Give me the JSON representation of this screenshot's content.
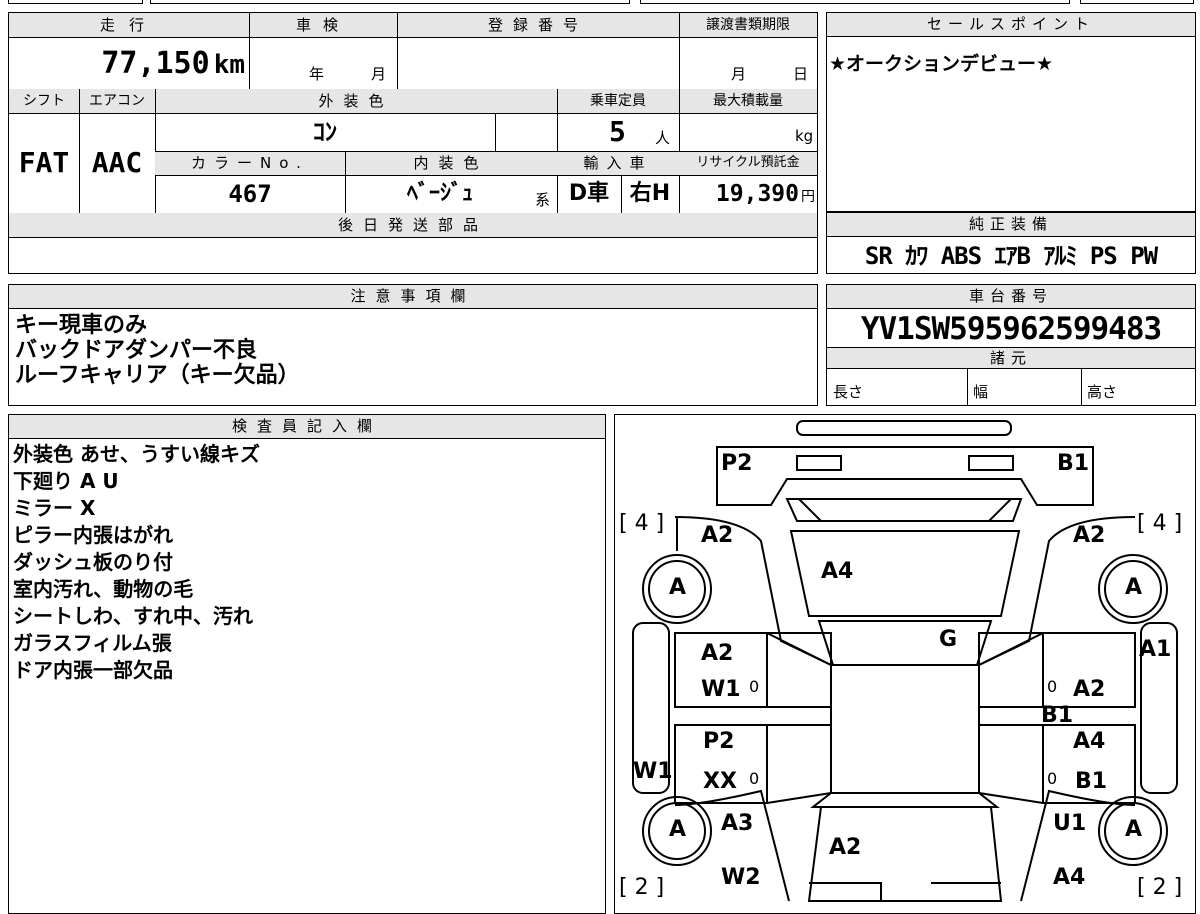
{
  "main": {
    "mileage_label": "走行",
    "mileage": "77,150",
    "mileage_unit": "km",
    "inspection_label": "車検",
    "inspection_year": "年",
    "inspection_month": "月",
    "registration_label": "登録番号",
    "transfer_label": "譲渡書類期限",
    "transfer_month": "月",
    "transfer_day": "日",
    "shift_label": "シフト",
    "shift": "FAT",
    "aircon_label": "エアコン",
    "aircon": "AAC",
    "exterior_label": "外装色",
    "exterior": "ｺﾝ",
    "capacity_label": "乗車定員",
    "capacity": "5",
    "capacity_unit": "人",
    "maxload_label": "最大積載量",
    "maxload_unit": "kg",
    "color_no_label": "カラーNo.",
    "color_no": "467",
    "interior_label": "内装色",
    "interior": "ﾍﾞｰｼﾞｭ",
    "interior_suffix": "系",
    "import_label": "輸入車",
    "import_type": "D車",
    "handle": "右H",
    "recycle_label": "リサイクル預託金",
    "recycle": "19,390",
    "recycle_unit": "円",
    "parts_label": "後日発送部品"
  },
  "sales": {
    "label": "セールスポイント",
    "text": "★オークションデビュー★"
  },
  "equipment": {
    "label": "純正装備",
    "text": "SR ｶﾜ ABS ｴｱB ｱﾙﾐ PS PW"
  },
  "notes": {
    "label": "注意事項欄",
    "lines": [
      "キー現車のみ",
      "バックドアダンパー不良",
      "ルーフキャリア（キー欠品）"
    ]
  },
  "chassis": {
    "label": "車台番号",
    "number": "YV1SW595962599483",
    "spec_label": "諸元",
    "length": "長さ",
    "width": "幅",
    "height": "高さ"
  },
  "inspector": {
    "label": "検査員記入欄",
    "lines": [
      "外装色 あせ、うすい線キズ",
      "下廻り A U",
      "ミラー X",
      "ピラー内張はがれ",
      "ダッシュ板のり付",
      "室内汚れ、動物の毛",
      "シートしわ、すれ中、汚れ",
      "ガラスフィルム張",
      "ドア内張一部欠品"
    ]
  },
  "diagram": {
    "corner_fl": "[ 4 ]",
    "corner_fr": "[ 4 ]",
    "corner_rl": "[ 2 ]",
    "corner_rr": "[ 2 ]",
    "tire": "A",
    "marks": {
      "p2_top": "P2",
      "b1_top": "B1",
      "a2_fl": "A2",
      "a2_fr": "A2",
      "a4_hood": "A4",
      "g_glass": "G",
      "a2_ld1": "A2",
      "w1_ld1": "W1",
      "zero1": "0",
      "p2_ld2": "P2",
      "xx_ld2": "XX",
      "zero2": "0",
      "w1_left": "W1",
      "a1_right": "A1",
      "zero3": "0",
      "a2_rd1": "A2",
      "b1_rd1": "B1",
      "a4_rd2": "A4",
      "zero4": "0",
      "b1_rd2": "B1",
      "a3_rl": "A3",
      "u1_rr": "U1",
      "a2_roof": "A2",
      "w2_rl": "W2",
      "a4_rr": "A4"
    }
  }
}
